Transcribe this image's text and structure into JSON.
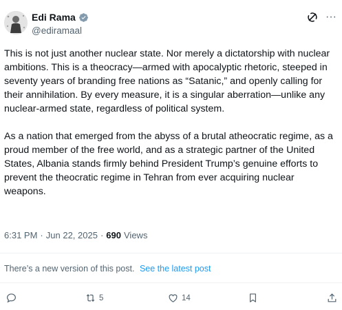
{
  "author": {
    "display_name": "Edi Rama",
    "handle": "@ediramaal",
    "verified": true
  },
  "header_icons": [
    "grok-icon",
    "more-icon"
  ],
  "more_label": "···",
  "post": {
    "paragraphs": [
      "This is not just another nuclear state. Nor merely a dictatorship with nuclear ambitions. This is a theocracy—armed with apocalyptic rhetoric, steeped in seventy years of branding free nations as “Satanic,” and openly calling for their annihilation. By every measure, it is a singular aberration—unlike any nuclear-armed state, regardless of political system.",
      "As a nation that emerged from the abyss of a brutal atheocratic regime, as a proud member of the free world, and as a strategic partner of the United States, Albania stands firmly behind President Trump’s genuine efforts to prevent the theocratic regime in Tehran from ever acquiring nuclear weapons."
    ]
  },
  "meta": {
    "time": "6:31 PM",
    "separator": "·",
    "date": "Jun 22, 2025",
    "views_count": "690",
    "views_label": "Views"
  },
  "notice": {
    "text": "There’s a new version of this post.",
    "link": "See the latest post"
  },
  "actions": {
    "reply_count": "",
    "repost_count": "5",
    "like_count": "14",
    "bookmark_count": "",
    "icons": [
      "reply-icon",
      "repost-icon",
      "like-icon",
      "bookmark-icon",
      "share-icon"
    ]
  },
  "colors": {
    "text": "#0f1419",
    "secondary": "#536471",
    "link": "#1d9bf0",
    "verified": "#829aab",
    "divider": "#eff3f4"
  }
}
